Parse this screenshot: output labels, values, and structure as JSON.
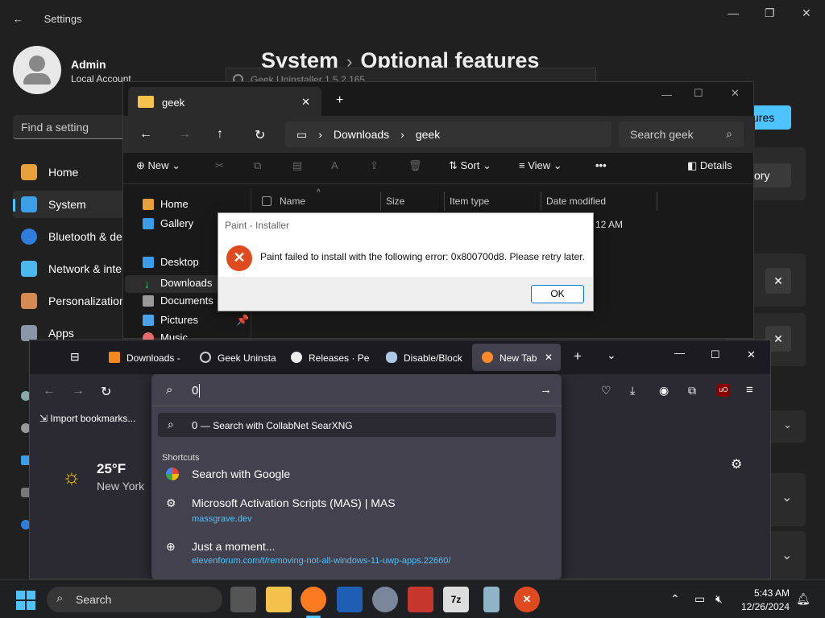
{
  "settings": {
    "title": "Settings",
    "user_name": "Admin",
    "account_type": "Local Account",
    "search_placeholder": "Find a setting",
    "nav": [
      "Home",
      "System",
      "Bluetooth & de",
      "Network & inte",
      "Personalization",
      "Apps"
    ],
    "breadcrumb_parent": "System",
    "breadcrumb_current": "Optional features",
    "partial_button_features": "ures",
    "partial_button_history": "ory"
  },
  "geek_uninstaller": {
    "title": "Geek Uninstaller 1.5.2.165"
  },
  "explorer": {
    "tab_title": "geek",
    "path": [
      "Downloads",
      "geek"
    ],
    "search_placeholder": "Search geek",
    "commands": {
      "new": "New",
      "sort": "Sort",
      "view": "View",
      "details": "Details"
    },
    "sidebar": [
      "Home",
      "Gallery",
      "Desktop",
      "Downloads",
      "Documents",
      "Pictures",
      "Music"
    ],
    "columns": [
      "Name",
      "Size",
      "Item type",
      "Date modified"
    ],
    "date_partial": "12 AM"
  },
  "dialog": {
    "title": "Paint - Installer",
    "message": "Paint failed to install with the following error: 0x800700d8. Please retry later.",
    "ok_label": "OK"
  },
  "firefox": {
    "tabs": [
      "Downloads -",
      "Geek Uninsta",
      "Releases · Pe",
      "Disable/Block",
      "New Tab"
    ],
    "import_bookmarks": "Import bookmarks...",
    "weather": {
      "temp": "25°F",
      "city": "New York"
    },
    "urlbar": {
      "input_value": "0",
      "suggestion_term": "0",
      "suggestion_text": "— Search with CollabNet SearXNG",
      "shortcuts_label": "Shortcuts",
      "items": [
        {
          "title": "Search with Google",
          "url": ""
        },
        {
          "title": "Microsoft Activation Scripts (MAS) | MAS",
          "url": "massgrave.dev"
        },
        {
          "title": "Just a moment...",
          "url": "elevenforum.com/t/removing-not-all-windows-11-uwp-apps.22660/"
        }
      ]
    }
  },
  "taskbar": {
    "search_label": "Search",
    "time": "5:43 AM",
    "date": "12/26/2024"
  }
}
